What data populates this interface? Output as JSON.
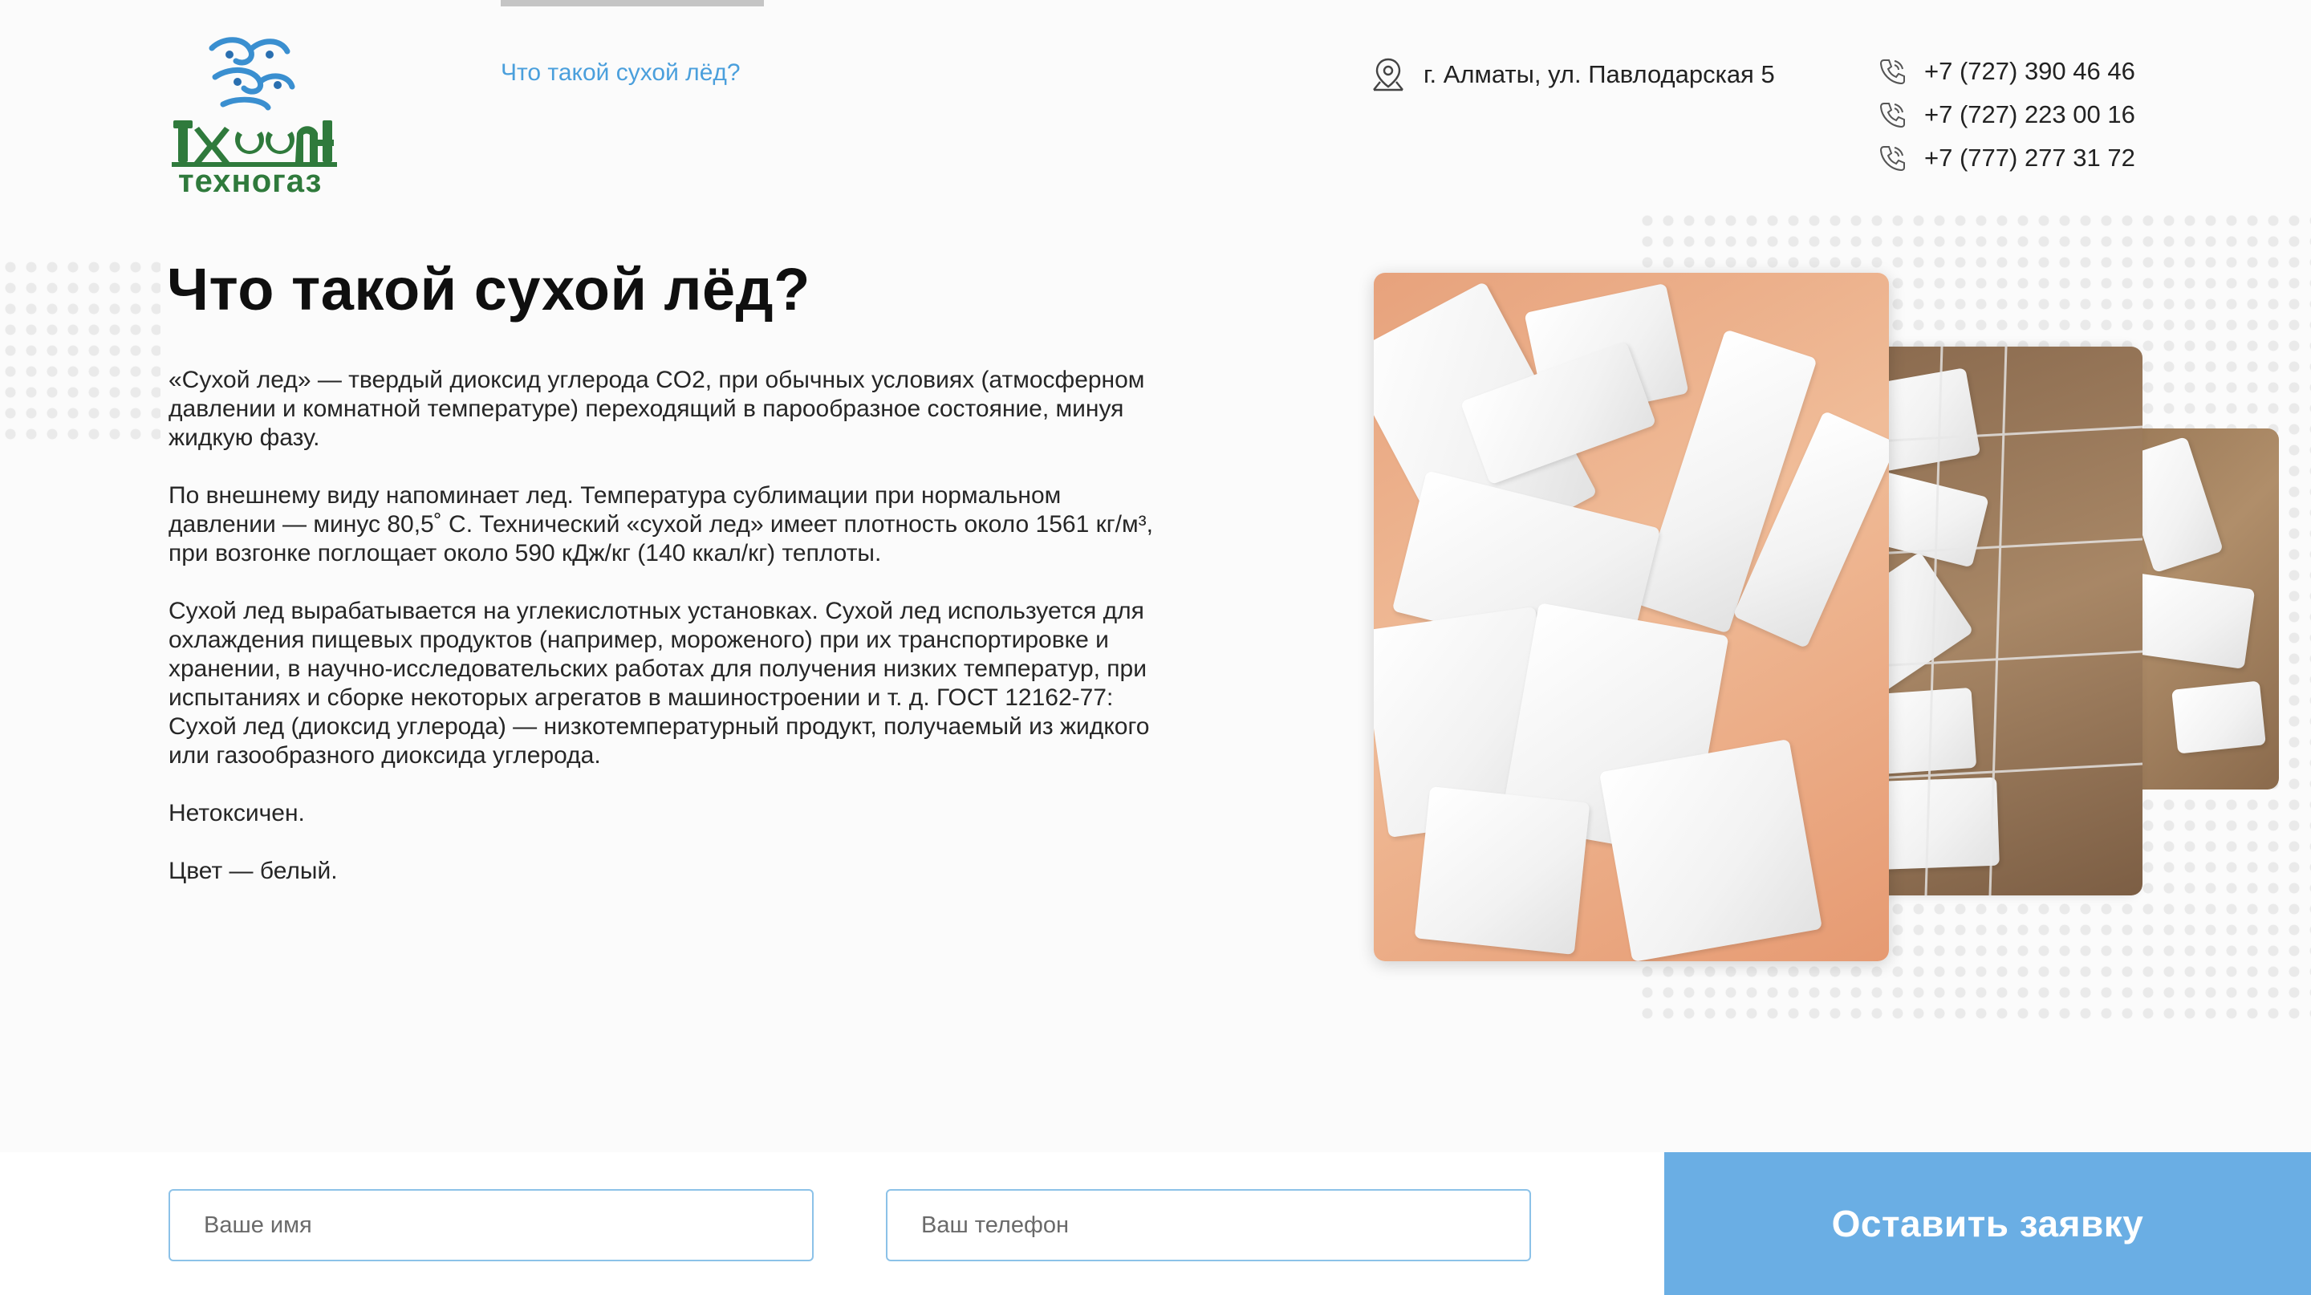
{
  "header": {
    "logo_text_main": "Ихсан",
    "logo_text_sub": "техногаз",
    "nav_link": "Что такой сухой лёд?",
    "address": "г. Алматы, ул. Павлодарская 5",
    "phones": [
      "+7 (727) 390 46 46",
      "+7 (727) 223 00 16",
      "+7 (777) 277 31 72"
    ]
  },
  "main": {
    "title": "Что такой сухой лёд?",
    "paragraphs": [
      "«Сухой лед» — твердый диоксид углерода CO2, при обычных условиях (атмосферном давлении и комнатной температуре) переходящий в парообразное состояние, минуя жидкую фазу.",
      "По внешнему виду напоминает лед. Температура сублимации при нормальном давлении — минус 80,5˚ С. Технический «сухой лед» имеет плотность около 1561 кг/м³, при возгонке поглощает около 590 кДж/кг (140 ккал/кг) теплоты.",
      "Сухой лед вырабатывается на углекислотных установках. Сухой лед используется для охлаждения пищевых продуктов (например, мороженого) при их транспортировке и хранении, в научно-исследовательских работах для получения низких температур, при испытаниях и сборке некоторых агрегатов в машиностроении и т. д. ГОСТ 12162-77: Сухой лед (диоксид углерода) — низкотемпературный продукт, получаемый из жидкого или газообразного диоксида углерода.",
      "Нетоксичен.",
      "Цвет — белый."
    ]
  },
  "form": {
    "name_placeholder": "Ваше имя",
    "phone_placeholder": "Ваш телефон",
    "submit_label": "Оставить заявку"
  },
  "colors": {
    "accent": "#6aaee4",
    "link": "#4a9fdc",
    "logo_green": "#2f7a3c",
    "logo_blue": "#3a8fd0"
  }
}
